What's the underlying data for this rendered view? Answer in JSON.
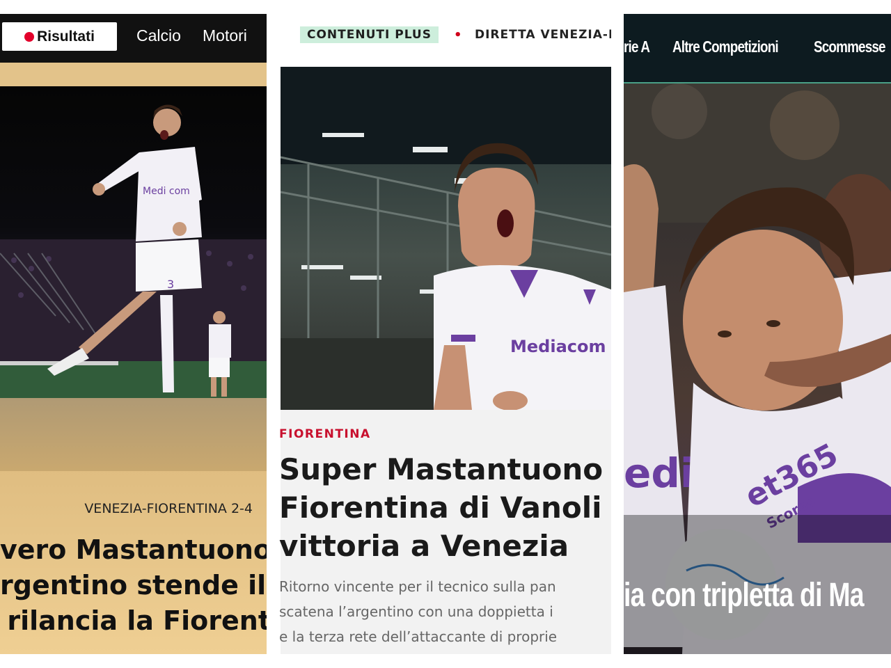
{
  "panel1": {
    "results_button": "Risultati",
    "nav_items": [
      "Calcio",
      "Motori"
    ],
    "kicker": "VENEZIA-FIORENTINA 2-4",
    "headline_lines": [
      "vero Mastantuono!",
      "rgentino stende il V",
      "rilancia la Fiorent"
    ],
    "player_number": "3",
    "jersey_text": "Medi com",
    "colors": {
      "topbar": "#111111",
      "accent_red": "#e3002b",
      "gold": "#caa868"
    }
  },
  "panel2": {
    "plus_tag": "CONTENUTI PLUS",
    "bullet": "•",
    "live_link": "DIRETTA VENEZIA-I",
    "section": "FIORENTINA",
    "headline_lines": [
      "Super Mastantuono",
      "Fiorentina di Vanoli c",
      "vittoria a Venezia"
    ],
    "subtitle_lines": [
      "Ritorno vincente per il tecnico sulla pan",
      "scatena l’argentino con una doppietta i",
      "e la terza rete dell’attaccante di proprie"
    ],
    "jersey_text": "Mediacom",
    "colors": {
      "plus_bg": "#cdeedc",
      "section": "#c8102e"
    }
  },
  "panel3": {
    "nav_items": [
      "rie A",
      "Altre Competizioni",
      "Scommesse"
    ],
    "headline": "ia con tripletta di Ma",
    "jersey_texts": [
      "edia",
      "et365",
      "Scores"
    ],
    "colors": {
      "topbar": "#0d1b20",
      "accent_green": "#4aa087"
    }
  }
}
